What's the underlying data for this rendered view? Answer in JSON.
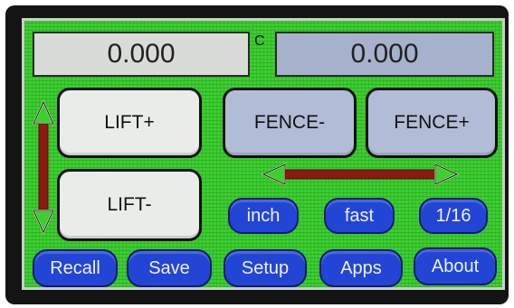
{
  "readouts": {
    "lift_value": "0.000",
    "unit_letter": "C",
    "fence_value": "0.000"
  },
  "buttons": {
    "lift_up": "LIFT+",
    "lift_down": "LIFT-",
    "fence_minus": "FENCE-",
    "fence_plus": "FENCE+"
  },
  "toggles": {
    "units": "inch",
    "speed": "fast",
    "step": "1/16"
  },
  "bottom_bar": [
    "Recall",
    "Save",
    "Setup",
    "Apps",
    "About"
  ],
  "colors": {
    "screen_bg": "#3ccf30",
    "pill_blue": "#2345d6",
    "arrow_red": "#8a1a12",
    "arrow_outline": "#f0ead0"
  }
}
